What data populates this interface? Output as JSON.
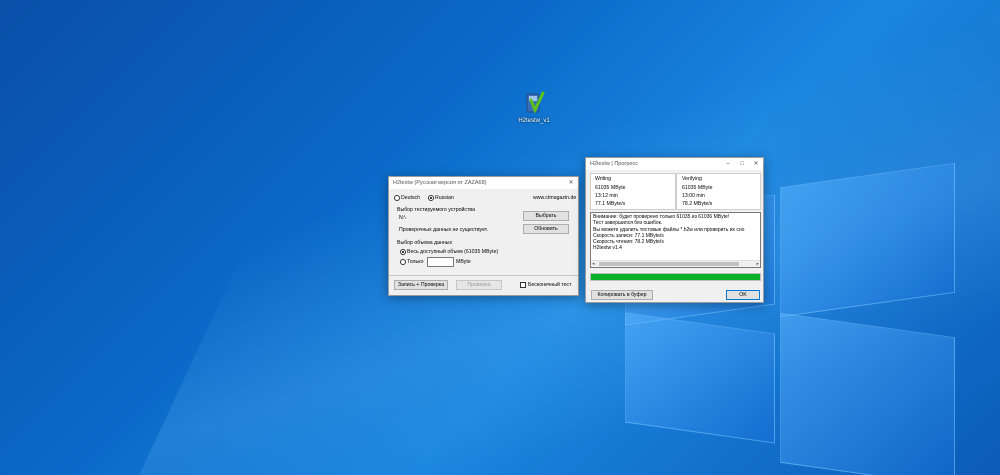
{
  "desktop": {
    "icon_label": "H2testw_v1"
  },
  "main_window": {
    "title": "H2testw (Русская версия от ZAZA68)",
    "lang_de": "Deutsch",
    "lang_ru": "Russian",
    "site": "www.ctmagazin.de",
    "device_heading": "Выбор тестируемого устройства",
    "device_path": "N:\\",
    "select_button": "Выбрать",
    "no_data_text": "Проверочных данных не существует.",
    "refresh_button": "Обновить",
    "volume_heading": "Выбор объема данных",
    "all_space": "Весь доступный объем (61035 MByte)",
    "only": "Только",
    "unit": "MByte",
    "write_verify_button": "Запись + Проверка",
    "verify_button": "Проверка",
    "endless_test": "Бесконечный тест"
  },
  "progress_window": {
    "title": "H2testw | Прогресс",
    "writing": {
      "heading": "Writing",
      "size": "61035 MByte",
      "time": "13:12 min",
      "speed": "77.1 MByte/s"
    },
    "verifying": {
      "heading": "Verifying",
      "size": "61035 MByte",
      "time": "13:00 min",
      "speed": "78.2 MByte/s"
    },
    "log": [
      "Внимание: будет проверено только 61035 из 61036 MByte!",
      "Тест завершился без ошибок.",
      "Вы можете удалить тестовые файлы *.h2w или проверить их сно",
      "Скорость записи: 77.1 MByte/s",
      "Скорость чтения: 78.2 MByte/s",
      "H2testw v1.4"
    ],
    "progress": 1.0,
    "copy_button": "Копировать в буфер",
    "ok_button": "OK"
  },
  "colors": {
    "progress_fill": "#06b025"
  }
}
